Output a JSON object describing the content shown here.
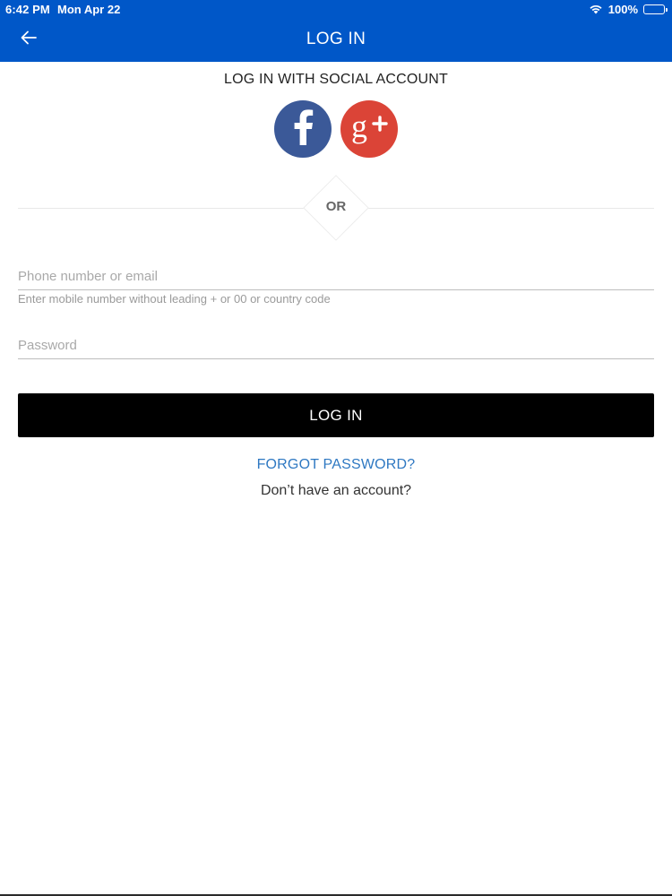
{
  "status_bar": {
    "time": "6:42 PM",
    "date": "Mon Apr 22",
    "battery": "100%",
    "icons": [
      "wifi-icon",
      "battery-icon"
    ]
  },
  "nav": {
    "title": "LOG IN",
    "back_icon": "arrow-left-icon"
  },
  "social": {
    "heading": "LOG IN WITH SOCIAL ACCOUNT",
    "facebook_label": "f",
    "google_label": "g+",
    "facebook_color": "#3B5998",
    "google_color": "#DB4437"
  },
  "divider": {
    "text": "OR"
  },
  "form": {
    "phone_placeholder": "Phone number or email",
    "phone_value": "",
    "phone_helper": "Enter mobile number without leading + or 00 or country code",
    "password_placeholder": "Password",
    "password_value": "",
    "login_label": "LOG IN"
  },
  "links": {
    "forgot_password": "FORGOT PASSWORD?",
    "signup_prompt": "Don’t have an account?"
  },
  "colors": {
    "header": "#0057C8",
    "link": "#2E78C2",
    "button": "#000000"
  }
}
